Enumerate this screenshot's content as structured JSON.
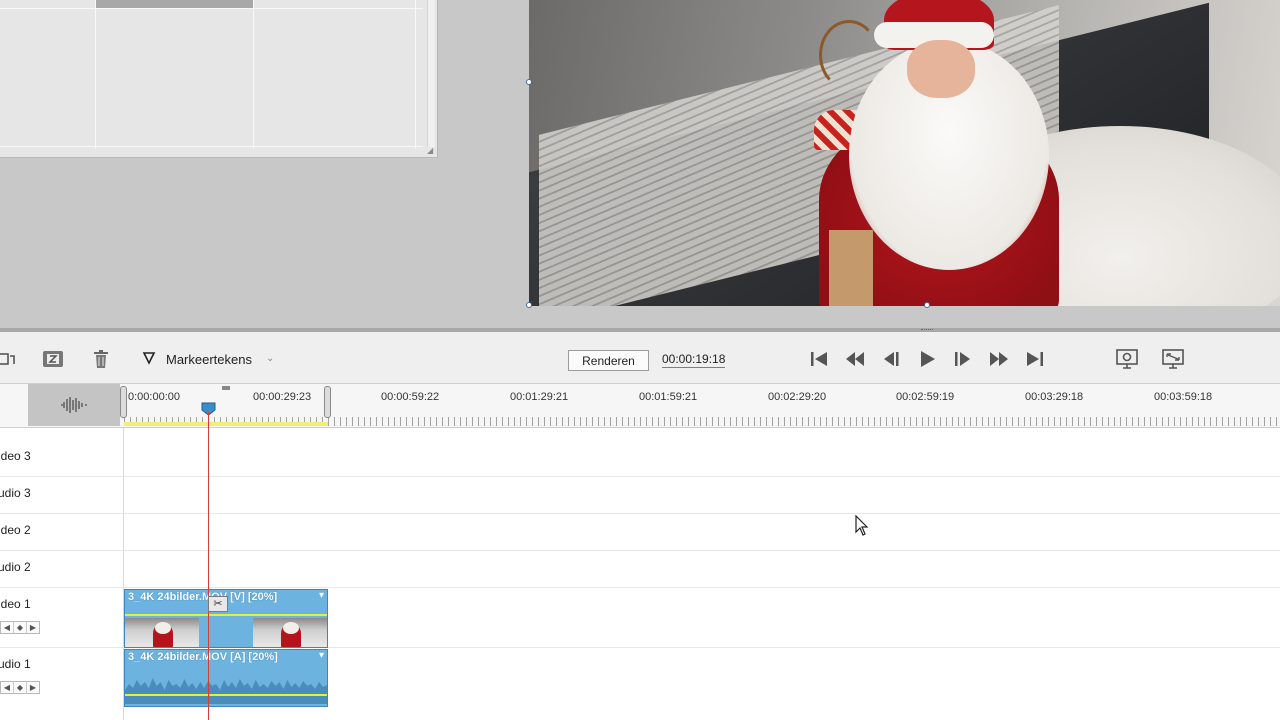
{
  "toolbar": {
    "marker_label": "Markeertekens",
    "render_label": "Renderen",
    "timecode": "00:00:19:18"
  },
  "ruler": {
    "ticks": [
      "0:00:00:00",
      "00:00:29:23",
      "00:00:59:22",
      "00:01:29:21",
      "00:01:59:21",
      "00:02:29:20",
      "00:02:59:19",
      "00:03:29:18",
      "00:03:59:18"
    ]
  },
  "tracks": {
    "video3": "ideo 3",
    "audio3": "udio 3",
    "video2": "ideo 2",
    "audio2": "udio 2",
    "video1": "ideo 1",
    "audio1": "udio 1"
  },
  "clips": {
    "video_title": "3_4K 24bilder.MOV [V] [20%]",
    "audio_title": "3_4K 24bilder.MOV [A] [20%]"
  },
  "colors": {
    "clip_fill": "#6db3e0",
    "clip_border": "#3d86bd",
    "playhead": "#d83a3a",
    "work_area": "#f2ef78"
  }
}
